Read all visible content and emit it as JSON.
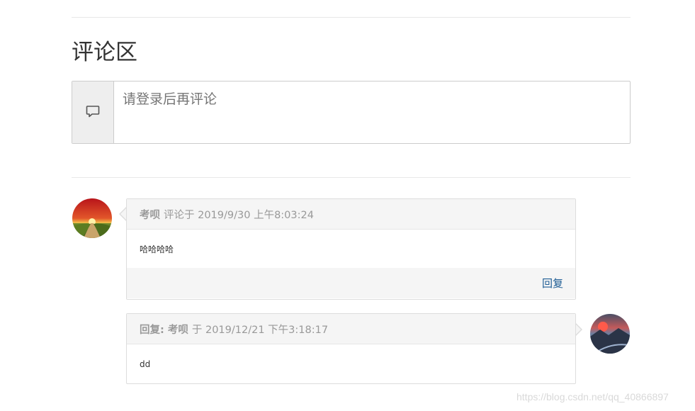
{
  "section": {
    "title": "评论区"
  },
  "comment_box": {
    "icon": "comment-icon",
    "placeholder": "请登录后再评论"
  },
  "comments": [
    {
      "author": "考呗",
      "meta": "评论于 2019/9/30 上午8:03:24",
      "content": "哈哈哈哈",
      "reply_label": "回复",
      "avatar": "sunset-road-avatar"
    },
    {
      "author": "回复: 考呗",
      "meta": "于 2019/12/21 下午3:18:17",
      "content": "dd",
      "avatar": "mountain-sunset-avatar"
    }
  ],
  "watermark": "https://blog.csdn.net/qq_40866897",
  "colors": {
    "link": "#1e5d95",
    "panel_bg": "#f5f5f5",
    "border": "#dddddd"
  }
}
